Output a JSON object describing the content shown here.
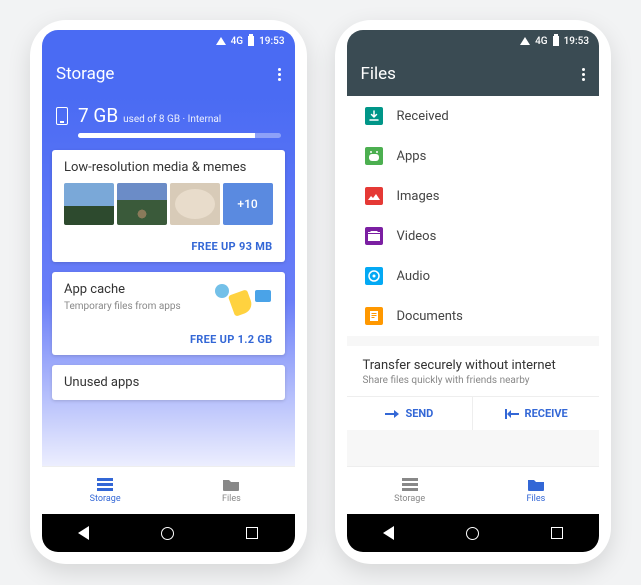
{
  "status": {
    "network": "4G",
    "time": "19:53"
  },
  "phone1": {
    "title": "Storage",
    "storage": {
      "used": "7 GB",
      "meta": "used of 8 GB · Internal",
      "percent": 87.5
    },
    "card_media": {
      "title": "Low-resolution media & memes",
      "more_badge": "+10",
      "action": "FREE UP 93 MB"
    },
    "card_cache": {
      "title": "App cache",
      "subtitle": "Temporary files from apps",
      "action": "FREE UP 1.2 GB"
    },
    "card_unused": {
      "title": "Unused apps"
    },
    "nav": {
      "storage": "Storage",
      "files": "Files"
    }
  },
  "phone2": {
    "title": "Files",
    "categories": [
      {
        "label": "Received"
      },
      {
        "label": "Apps"
      },
      {
        "label": "Images"
      },
      {
        "label": "Videos"
      },
      {
        "label": "Audio"
      },
      {
        "label": "Documents"
      }
    ],
    "transfer": {
      "title": "Transfer securely without internet",
      "subtitle": "Share files quickly with friends nearby",
      "send": "SEND",
      "receive": "RECEIVE"
    },
    "nav": {
      "storage": "Storage",
      "files": "Files"
    }
  }
}
